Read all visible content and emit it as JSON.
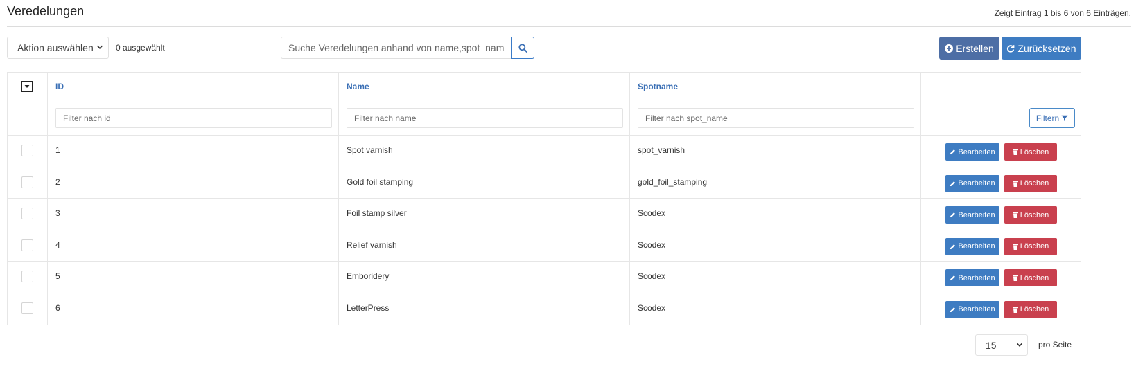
{
  "header": {
    "title": "Veredelungen",
    "entries_info": "Zeigt Eintrag 1 bis 6 von 6 Einträgen."
  },
  "toolbar": {
    "action_select": "Aktion auswählen",
    "selected_count": "0 ausgewählt",
    "search_placeholder": "Suche Veredelungen anhand von name,spot_name...",
    "create_label": "Erstellen",
    "reset_label": "Zurücksetzen"
  },
  "table": {
    "columns": [
      "ID",
      "Name",
      "Spotname"
    ],
    "filters": {
      "id_placeholder": "Filter nach id",
      "name_placeholder": "Filter nach name",
      "spot_placeholder": "Filter nach spot_name",
      "button_label": "Filtern"
    },
    "rows": [
      {
        "id": "1",
        "name": "Spot varnish",
        "spot_name": "spot_varnish"
      },
      {
        "id": "2",
        "name": "Gold foil stamping",
        "spot_name": "gold_foil_stamping"
      },
      {
        "id": "3",
        "name": "Foil stamp silver",
        "spot_name": "Scodex"
      },
      {
        "id": "4",
        "name": "Relief varnish",
        "spot_name": "Scodex"
      },
      {
        "id": "5",
        "name": "Emboridery",
        "spot_name": "Scodex"
      },
      {
        "id": "6",
        "name": "LetterPress",
        "spot_name": "Scodex"
      }
    ],
    "edit_label": "Bearbeiten",
    "delete_label": "Löschen"
  },
  "pagination": {
    "per_page_value": "15",
    "per_page_label": "pro Seite"
  },
  "colors": {
    "primary": "#3e7cc2",
    "create": "#4d6ea5",
    "danger": "#c9404e",
    "header_link": "#3a6fb5"
  },
  "icons": {
    "search": "search-icon",
    "create": "plus-circle-icon",
    "reset": "refresh-icon",
    "filter": "filter-icon",
    "edit": "pencil-icon",
    "delete": "trash-icon"
  }
}
